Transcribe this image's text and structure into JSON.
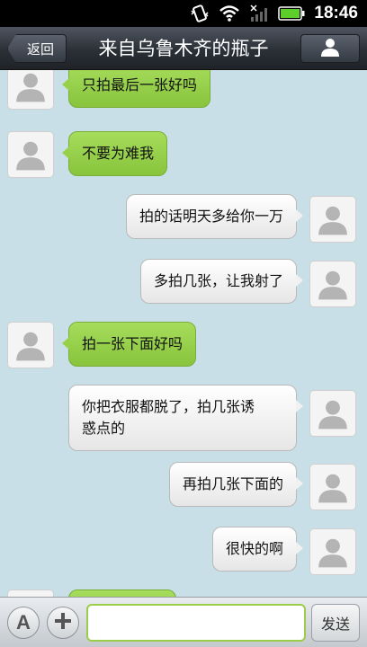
{
  "status_bar": {
    "time": "18:46",
    "icons": [
      "vibrate-icon",
      "wifi-icon",
      "signal-icon",
      "battery-icon"
    ]
  },
  "header": {
    "back_label": "返回",
    "title": "来自乌鲁木齐的瓶子",
    "profile_icon": "person-icon"
  },
  "messages": [
    {
      "side": "left",
      "text": "只拍最后一张好吗"
    },
    {
      "side": "left",
      "text": "不要为难我"
    },
    {
      "side": "right",
      "text": "拍的话明天多给你一万"
    },
    {
      "side": "right",
      "text": "多拍几张，让我射了"
    },
    {
      "side": "left",
      "text": "拍一张下面好吗"
    },
    {
      "side": "right",
      "text": "你把衣服都脱了，拍几张诱\n惑点的"
    },
    {
      "side": "right",
      "text": "再拍几张下面的"
    },
    {
      "side": "right",
      "text": "很快的啊"
    },
    {
      "side": "left",
      "text": ""
    }
  ],
  "input_bar": {
    "emoji_label": "A",
    "plus_icon": "plus-icon",
    "input_value": "",
    "send_label": "发送"
  },
  "colors": {
    "chat_background": "#c8dfe8",
    "incoming_bubble": "#98d04a",
    "outgoing_bubble": "#f1f1f1",
    "input_border": "#9acd4a"
  }
}
